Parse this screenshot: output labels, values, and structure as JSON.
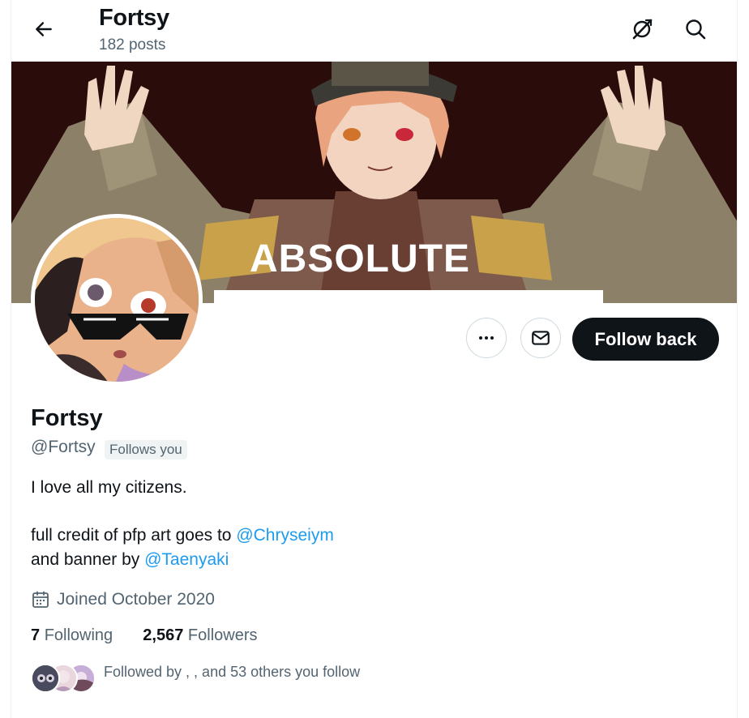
{
  "header": {
    "name": "Fortsy",
    "post_count": "182 posts"
  },
  "banner": {
    "text": "ABSOLUTE"
  },
  "actions": {
    "follow_label": "Follow back"
  },
  "profile": {
    "display_name": "Fortsy",
    "handle": "@Fortsy",
    "follows_badge": "Follows you",
    "bio_line1": "I love all my citizens.",
    "bio_line2_prefix": "full credit of pfp art goes to ",
    "bio_line2_mention": "@Chryseiym",
    "bio_line3_prefix": "and banner by ",
    "bio_line3_mention": "@Taenyaki",
    "joined": "Joined October 2020"
  },
  "stats": {
    "following_count": "7",
    "following_label": "Following",
    "followers_count": "2,567",
    "followers_label": "Followers"
  },
  "followed_by": {
    "text": "Followed by , , and 53 others you follow"
  },
  "colors": {
    "link": "#1d9bf0",
    "secondary_text": "#536471",
    "primary_text": "#0f1419",
    "banner_bg": "#2a0c0b"
  },
  "icons": [
    "back-arrow-icon",
    "grok-icon",
    "search-icon",
    "more-icon",
    "message-icon",
    "calendar-icon"
  ]
}
